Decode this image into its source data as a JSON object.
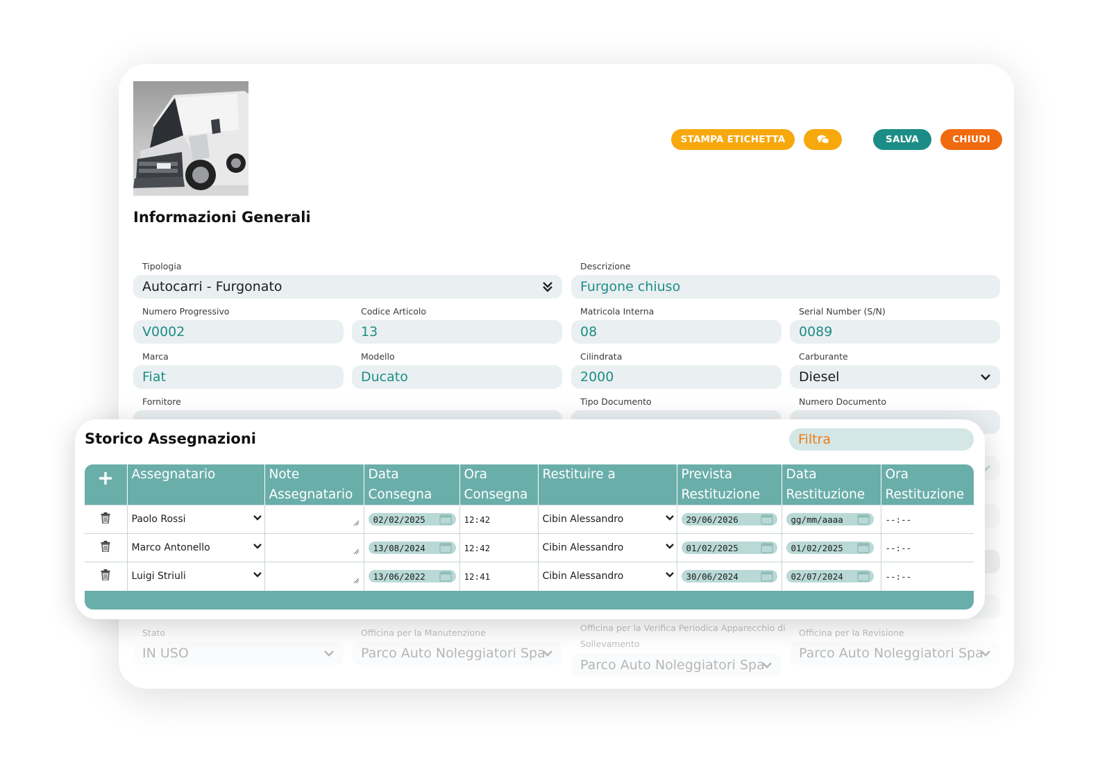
{
  "header": {
    "buttons": {
      "print_label": "STAMPA ETICHETTA",
      "save_label": "SALVA",
      "close_label": "CHIUDI"
    }
  },
  "section_title": "Informazioni Generali",
  "form": {
    "tipologia": {
      "label": "Tipologia",
      "value": "Autocarri - Furgonato"
    },
    "descrizione": {
      "label": "Descrizione",
      "value": "Furgone chiuso"
    },
    "numero_progressivo": {
      "label": "Numero Progressivo",
      "value": "V0002"
    },
    "codice_articolo": {
      "label": "Codice Articolo",
      "value": "13"
    },
    "matricola_interna": {
      "label": "Matricola Interna",
      "value": "08"
    },
    "serial_number": {
      "label": "Serial Number (S/N)",
      "value": "0089"
    },
    "marca": {
      "label": "Marca",
      "value": "Fiat"
    },
    "modello": {
      "label": "Modello",
      "value": "Ducato"
    },
    "cilindrata": {
      "label": "Cilindrata",
      "value": "2000"
    },
    "carburante": {
      "label": "Carburante",
      "value": "Diesel"
    },
    "fornitore": {
      "label": "Fornitore"
    },
    "tipo_documento": {
      "label": "Tipo Documento"
    },
    "numero_documento": {
      "label": "Numero Documento"
    },
    "stato": {
      "label": "Stato",
      "value": "IN USO"
    },
    "officina_manutenzione": {
      "label": "Officina per la Manutenzione",
      "value": "Parco Auto Noleggiatori Spa"
    },
    "officina_verifica": {
      "label": "Officina per la Verifica Periodica Apparecchio di",
      "label2": "Sollevamento",
      "value": "Parco Auto Noleggiatori Spa"
    },
    "officina_revisione": {
      "label": "Officina per la Revisione",
      "value": "Parco Auto Noleggiatori Spa"
    }
  },
  "storico": {
    "title": "Storico Assegnazioni",
    "filter_placeholder": "Filtra",
    "columns": [
      {
        "l1": "Assegnatario",
        "l2": ""
      },
      {
        "l1": "Note",
        "l2": "Assegnatario"
      },
      {
        "l1": "Data",
        "l2": "Consegna"
      },
      {
        "l1": "Ora",
        "l2": "Consegna"
      },
      {
        "l1": "Restituire a",
        "l2": ""
      },
      {
        "l1": "Prevista",
        "l2": "Restituzione"
      },
      {
        "l1": "Data",
        "l2": "Restituzione"
      },
      {
        "l1": "Ora",
        "l2": "Restituzione"
      }
    ],
    "rows": [
      {
        "assegnatario": "Paolo Rossi",
        "data_consegna": "02/02/2025",
        "ora_consegna": "12:42",
        "restituire_a": "Cibin Alessandro",
        "prevista": "29/06/2026",
        "data_restituzione": "gg/mm/aaaa",
        "ora_restituzione": "--:--"
      },
      {
        "assegnatario": "Marco Antonello",
        "data_consegna": "13/08/2024",
        "ora_consegna": "12:42",
        "restituire_a": "Cibin Alessandro",
        "prevista": "01/02/2025",
        "data_restituzione": "01/02/2025",
        "ora_restituzione": "--:--"
      },
      {
        "assegnatario": "Luigi Striuli",
        "data_consegna": "13/06/2022",
        "ora_consegna": "12:41",
        "restituire_a": "Cibin Alessandro",
        "prevista": "30/06/2024",
        "data_restituzione": "02/07/2024",
        "ora_restituzione": "--:--"
      }
    ]
  },
  "colors": {
    "teal": "#1b8d86",
    "table_teal": "#6aaeaa",
    "yellow": "#f7a80d",
    "orange": "#f06a0f"
  },
  "icons": [
    "van-photo",
    "chat-icon",
    "double-chevron-down-icon",
    "chevron-down-icon",
    "plus-icon",
    "trash-icon",
    "calendar-icon",
    "resize-handle-icon"
  ]
}
